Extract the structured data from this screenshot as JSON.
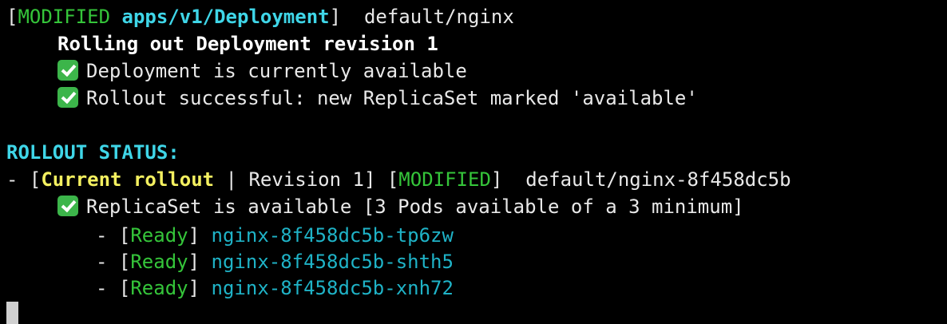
{
  "header": {
    "open": "[",
    "status": "MODIFIED",
    "kind": "apps/v1/Deployment",
    "close": "]",
    "resource": "  default/nginx"
  },
  "deployment": {
    "title": "Rolling out Deployment revision 1",
    "checks": [
      "Deployment is currently available",
      "Rollout successful: new ReplicaSet marked 'available'"
    ]
  },
  "rollout": {
    "heading": "ROLLOUT STATUS:",
    "prefix": "- [",
    "current": "Current rollout",
    "revision": " | Revision 1] [",
    "status": "MODIFIED",
    "status_close": "]",
    "replicaset": "  default/nginx-8f458dc5b",
    "replicaset_check": "ReplicaSet is available [3 Pods available of a 3 minimum]",
    "pods": [
      {
        "prefix": "- [",
        "state": "Ready",
        "suffix": "] ",
        "name": "nginx-8f458dc5b-tp6zw"
      },
      {
        "prefix": "- [",
        "state": "Ready",
        "suffix": "] ",
        "name": "nginx-8f458dc5b-shth5"
      },
      {
        "prefix": "- [",
        "state": "Ready",
        "suffix": "] ",
        "name": "nginx-8f458dc5b-xnh72"
      }
    ]
  },
  "icons": {
    "check": "check-mark-icon"
  },
  "colors": {
    "background": "#000000",
    "text": "#e8e8e8",
    "green": "#35c53a",
    "cyan": "#3fd6e8",
    "pod_cyan": "#1fb3c7",
    "yellow": "#f4f060",
    "check_bg": "#3cb54a"
  }
}
